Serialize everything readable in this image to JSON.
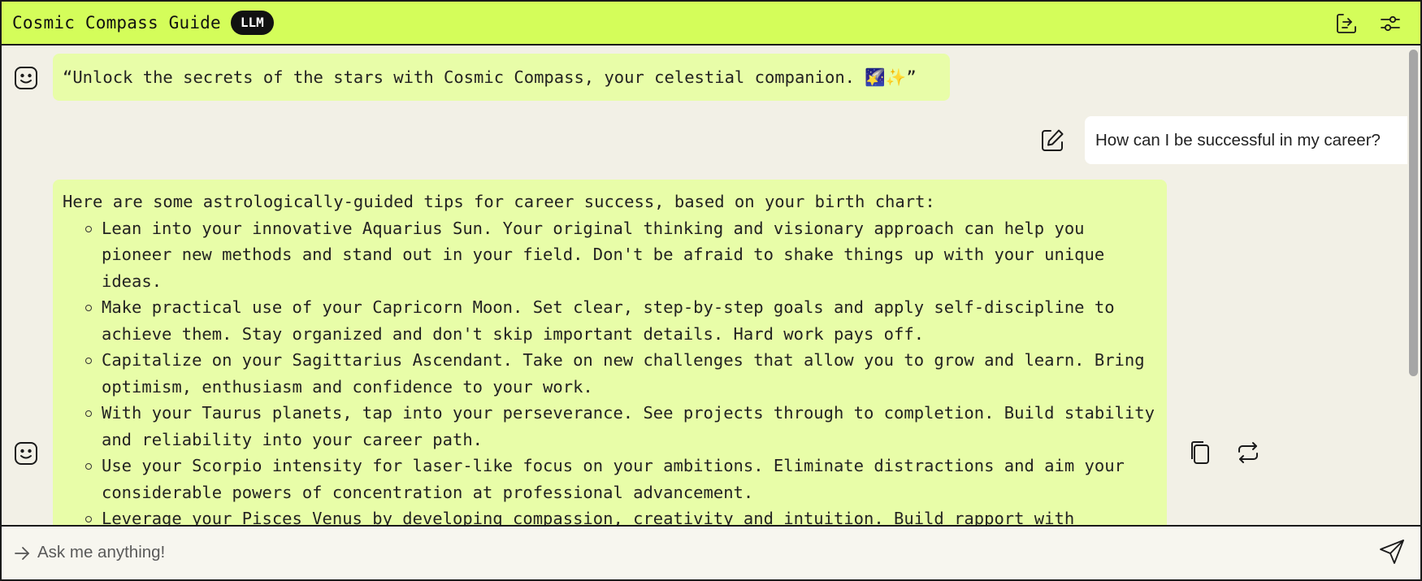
{
  "header": {
    "title": "Cosmic Compass Guide",
    "badge": "LLM",
    "share_icon": "share-chat-icon",
    "settings_icon": "sliders-settings-icon",
    "background_color": "#d4fd5a"
  },
  "messages": {
    "greeting": "“Unlock the secrets of the stars with Cosmic Compass, your celestial companion. 🌠✨”",
    "user_question": "How can I be successful in my career?",
    "answer": {
      "intro": "Here are some astrologically-guided tips for career success, based on your birth chart:",
      "tips": [
        "Lean into your innovative Aquarius Sun. Your original thinking and visionary approach can help you pioneer new methods and stand out in your field. Don't be afraid to shake things up with your unique ideas.",
        "Make practical use of your Capricorn Moon. Set clear, step-by-step goals and apply self-discipline to achieve them. Stay organized and don't skip important details. Hard work pays off.",
        "Capitalize on your Sagittarius Ascendant. Take on new challenges that allow you to grow and learn. Bring optimism, enthusiasm and confidence to your work.",
        "With your Taurus planets, tap into your perseverance. See projects through to completion. Build stability and reliability into your career path.",
        "Use your Scorpio intensity for laser-like focus on your ambitions. Eliminate distractions and aim your considerable powers of concentration at professional advancement.",
        "Leverage your Pisces Venus by developing compassion, creativity and intuition. Build rapport with"
      ]
    },
    "bot_avatar_icon": "smiley-avatar-icon",
    "bubble_color": "#e8fda8"
  },
  "input": {
    "placeholder": "Ask me anything!",
    "value": ""
  }
}
